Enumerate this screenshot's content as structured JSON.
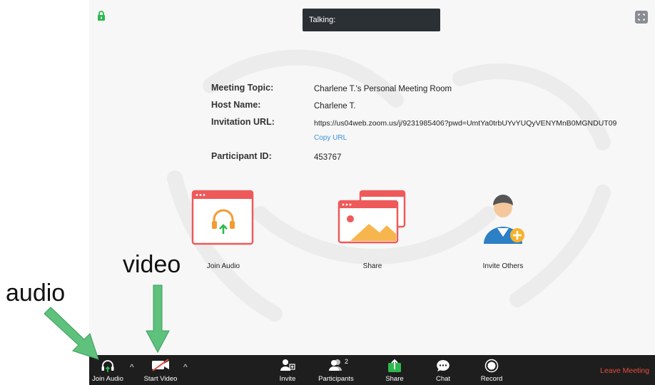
{
  "header": {
    "talking_label": "Talking:"
  },
  "meeting_info": {
    "topic_label": "Meeting Topic:",
    "topic_value": "Charlene T.'s Personal Meeting Room",
    "host_label": "Host Name:",
    "host_value": "Charlene T.",
    "url_label": "Invitation URL:",
    "url_value": "https://us04web.zoom.us/j/9231985406?pwd=UmtYa0trbUYvYUQyVENYMnB0MGNDUT09",
    "copy_url": "Copy URL",
    "participant_label": "Participant ID:",
    "participant_value": "453767"
  },
  "actions": {
    "join_audio": "Join Audio",
    "share": "Share",
    "invite_others": "Invite Others"
  },
  "toolbar": {
    "join_audio": "Join Audio",
    "start_video": "Start Video",
    "invite": "Invite",
    "participants": "Participants",
    "participant_count": "2",
    "share": "Share",
    "chat": "Chat",
    "record": "Record",
    "leave": "Leave Meeting"
  },
  "annotations": {
    "video": "video",
    "audio": "audio"
  },
  "colors": {
    "toolbar_bg": "#1e1e1e",
    "leave": "#e74c3c",
    "share_green": "#2db84d",
    "accent_red": "#ee5a5a",
    "annotation_arrow": "#5ec27c"
  }
}
